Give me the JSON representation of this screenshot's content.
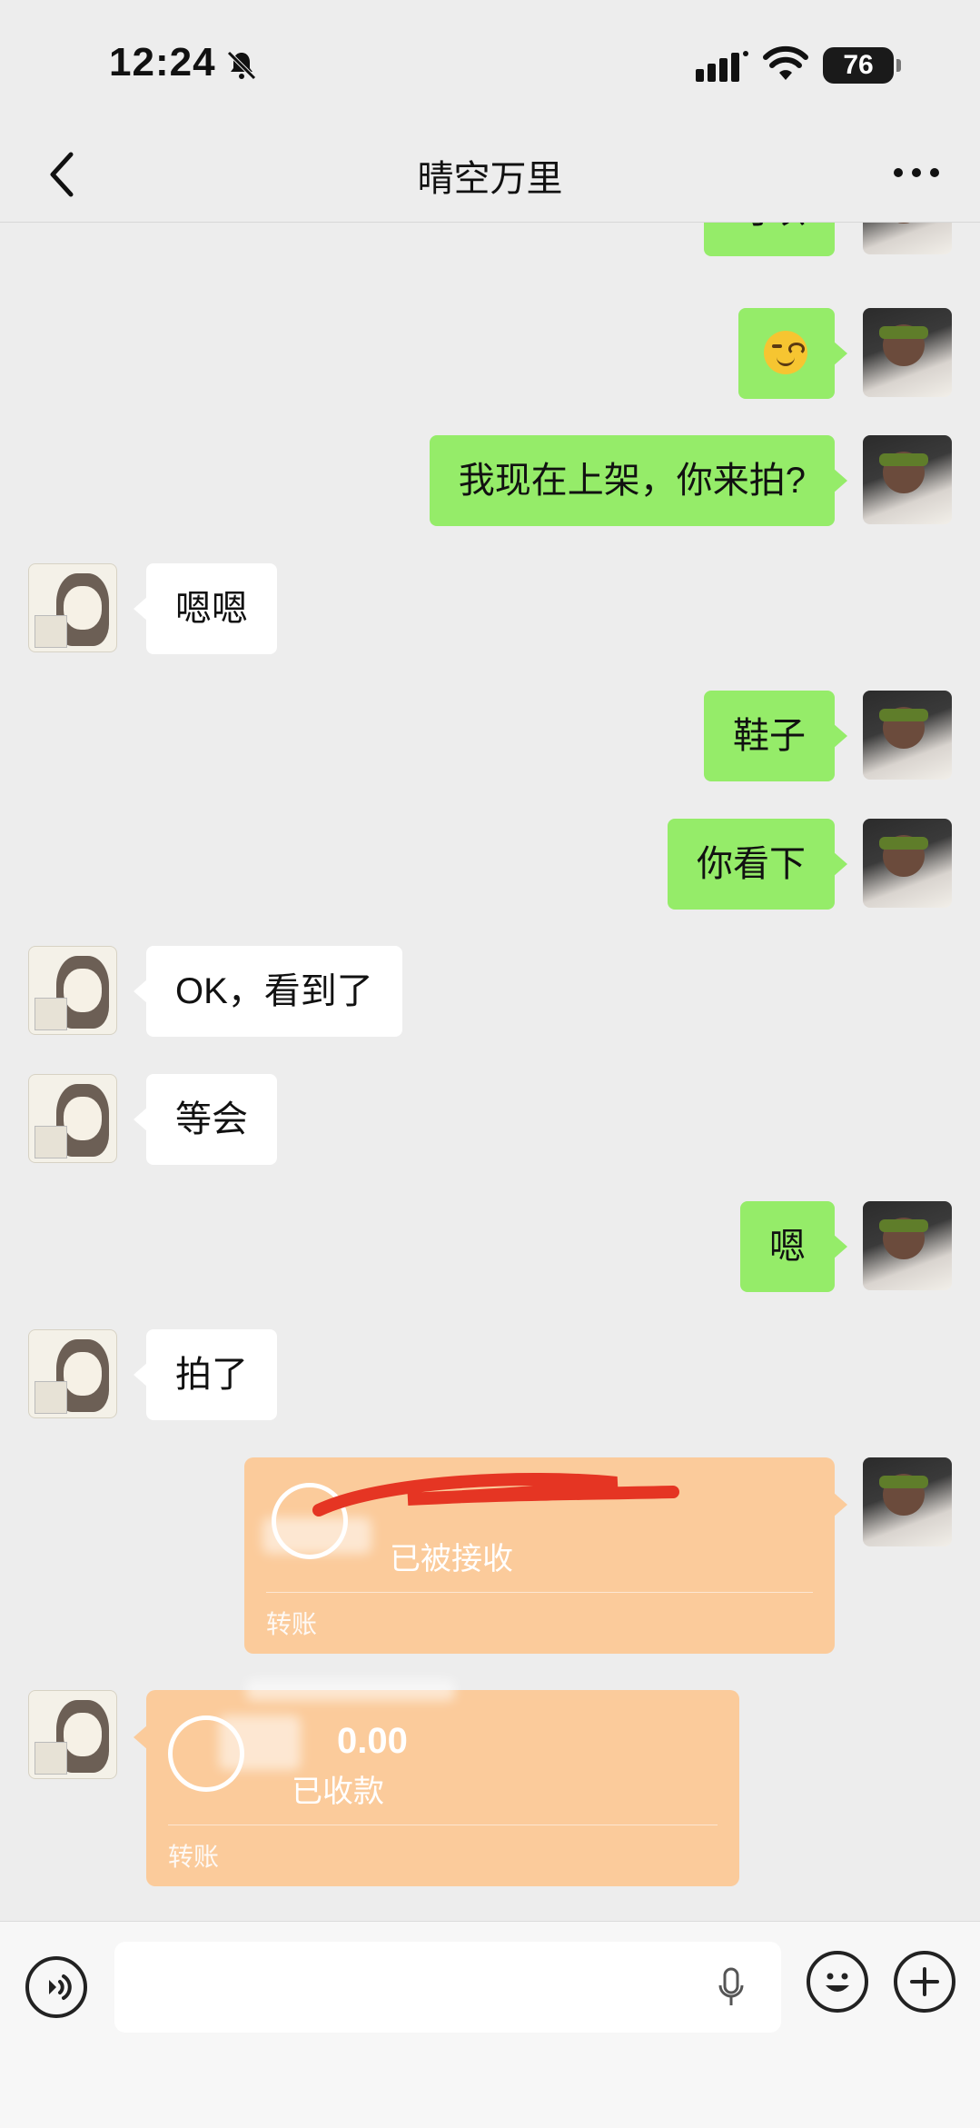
{
  "status_bar": {
    "time": "12:24",
    "battery": "76"
  },
  "nav": {
    "title": "晴空万里"
  },
  "messages": [
    {
      "side": "me",
      "text": "可以"
    },
    {
      "side": "me",
      "emoji": "smirk-emoji"
    },
    {
      "side": "me",
      "text": "我现在上架，你来拍?"
    },
    {
      "side": "other",
      "text": "嗯嗯"
    },
    {
      "side": "me",
      "text": "鞋子"
    },
    {
      "side": "me",
      "text": "你看下"
    },
    {
      "side": "other",
      "text": "OK，看到了"
    },
    {
      "side": "other",
      "text": "等会"
    },
    {
      "side": "me",
      "text": "嗯"
    },
    {
      "side": "other",
      "text": "拍了"
    }
  ],
  "transfers": [
    {
      "side": "me",
      "status": "已被接收",
      "type": "转账"
    },
    {
      "side": "other",
      "amount": "0.00",
      "status": "已收款",
      "type": "转账"
    }
  ],
  "colors": {
    "my_bubble": "#95ec69",
    "their_bubble": "#ffffff",
    "transfer_card": "#fbcb9b",
    "background": "#ededed"
  }
}
